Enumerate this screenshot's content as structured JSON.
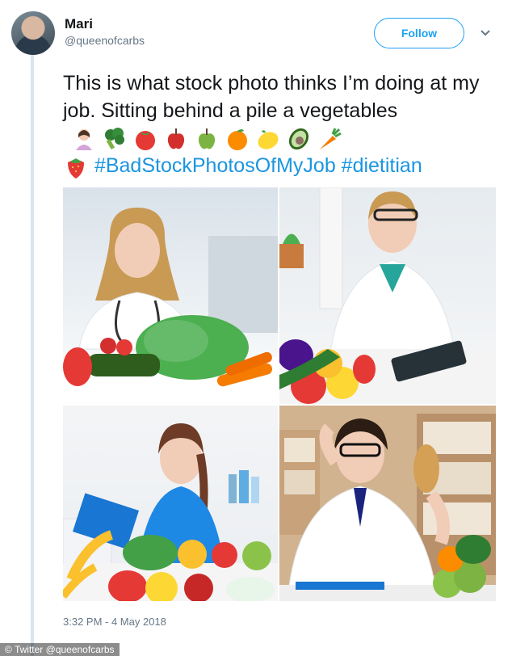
{
  "tweet": {
    "author_name": "Mari",
    "author_handle": "@queenofcarbs",
    "follow_label": "Follow",
    "text_line": "This is what stock photo thinks I’m doing at my job. Sitting behind a pile a vegetables",
    "hashtags": "#BadStockPhotosOfMyJob #dietitian",
    "timestamp": "3:32 PM - 4 May 2018"
  },
  "emojis": [
    "woman-icon",
    "broccoli-icon",
    "tomato-icon",
    "red-apple-icon",
    "green-apple-icon",
    "orange-icon",
    "lemon-icon",
    "avocado-icon",
    "carrot-icon",
    "strawberry-icon"
  ],
  "photos": [
    {
      "name": "photo-woman-vegetables"
    },
    {
      "name": "photo-woman-tablet"
    },
    {
      "name": "photo-woman-clipboard"
    },
    {
      "name": "photo-man-bread"
    }
  ],
  "credit": "© Twitter @queenofcarbs",
  "colors": {
    "accent": "#1da1f2",
    "hashtag": "#1b95e0",
    "muted": "#657786"
  }
}
